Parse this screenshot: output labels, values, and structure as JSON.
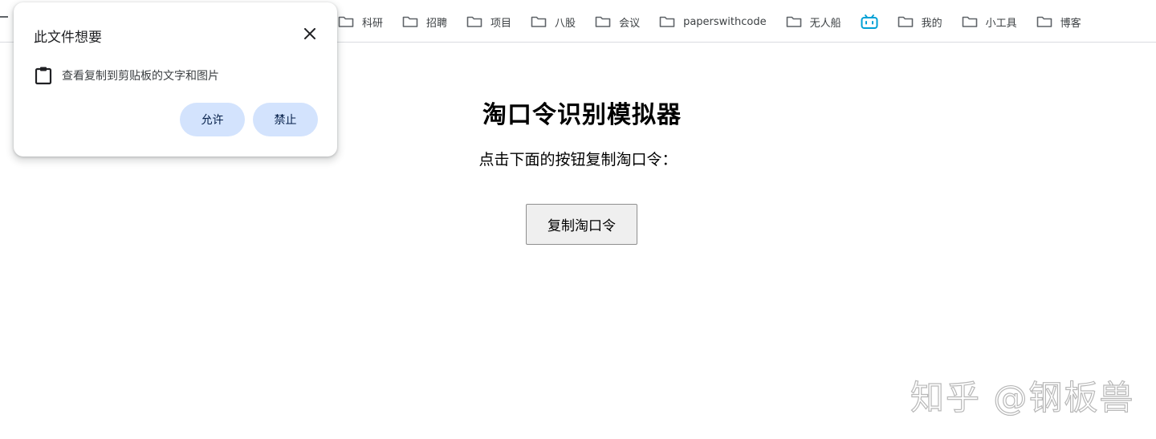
{
  "bookmarks": [
    {
      "label": "科研",
      "icon": "folder-icon"
    },
    {
      "label": "招聘",
      "icon": "folder-icon"
    },
    {
      "label": "项目",
      "icon": "folder-icon"
    },
    {
      "label": "八股",
      "icon": "folder-icon"
    },
    {
      "label": "会议",
      "icon": "folder-icon"
    },
    {
      "label": "paperswithcode",
      "icon": "folder-icon"
    },
    {
      "label": "无人船",
      "icon": "folder-icon"
    },
    {
      "label": "",
      "icon": "bilibili-tv-icon"
    },
    {
      "label": "我的",
      "icon": "folder-icon"
    },
    {
      "label": "小工具",
      "icon": "folder-icon"
    },
    {
      "label": "博客",
      "icon": "folder-icon"
    }
  ],
  "permission_popup": {
    "title": "此文件想要",
    "description": "查看复制到剪贴板的文字和图片",
    "allow_label": "允许",
    "block_label": "禁止",
    "icon": "clipboard-icon"
  },
  "page": {
    "title": "淘口令识别模拟器",
    "subtitle": "点击下面的按钮复制淘口令：",
    "copy_button_label": "复制淘口令"
  },
  "watermark": "知乎 @钢板兽",
  "colors": {
    "popup_button_bg": "#d3e3fd",
    "bilibili_blue": "#00a1d6",
    "page_button_bg": "#efefef"
  }
}
